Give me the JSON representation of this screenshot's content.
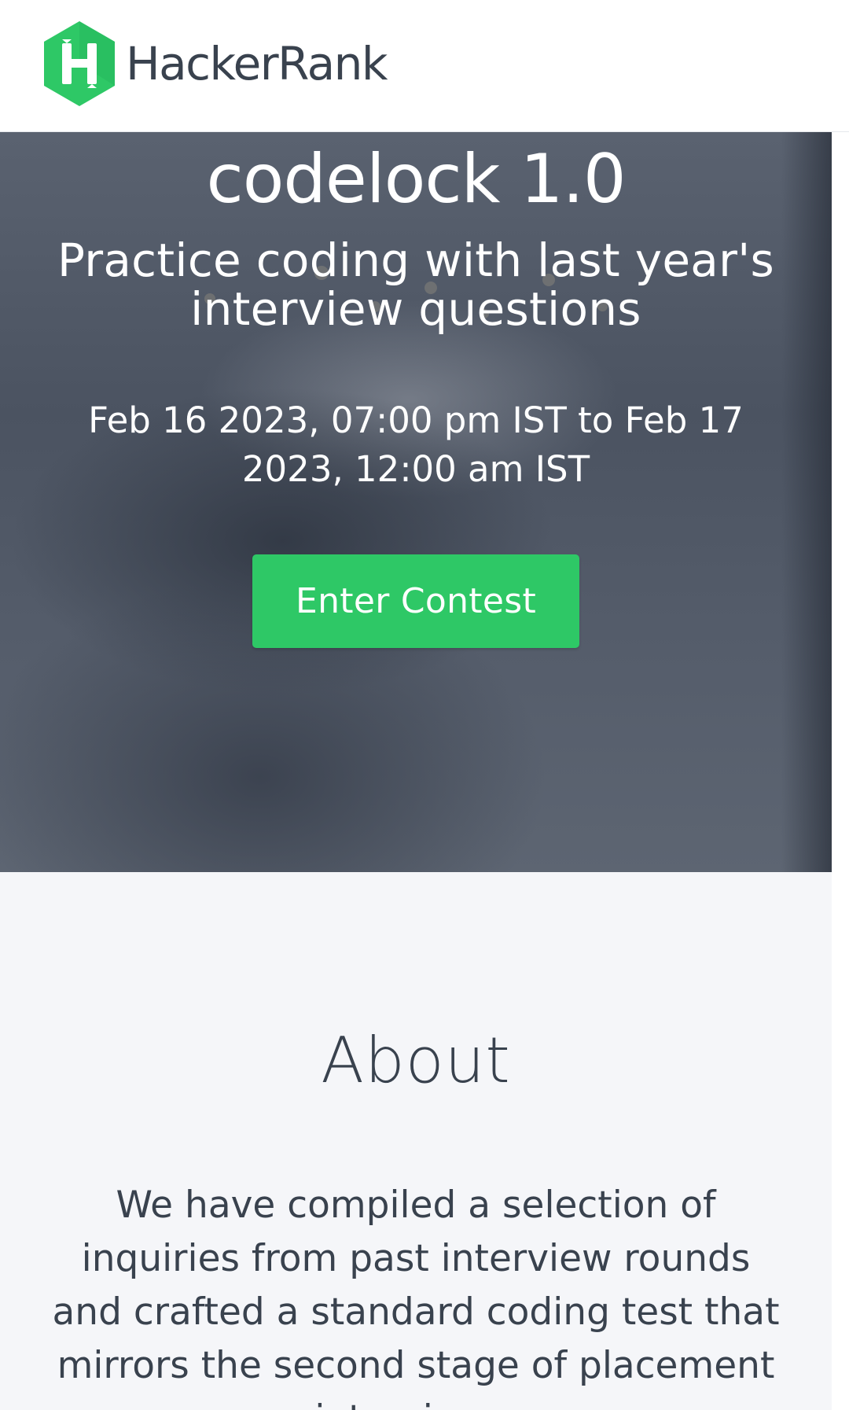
{
  "header": {
    "brand_name": "HackerRank",
    "logo_icon": "hackerrank-h-logo-icon",
    "brand_color": "#2ec866"
  },
  "hero": {
    "title": "codelock 1.0",
    "subtitle": "Practice coding with last year's interview questions",
    "dates": "Feb 16 2023, 07:00 pm IST to Feb 17 2023, 12:00 am IST",
    "enter_button_label": "Enter Contest",
    "button_color": "#2ec866"
  },
  "about": {
    "title": "About",
    "text": "We have compiled a selection of inquiries from past interview rounds and crafted a standard coding test that mirrors the second stage of placement interviews."
  }
}
